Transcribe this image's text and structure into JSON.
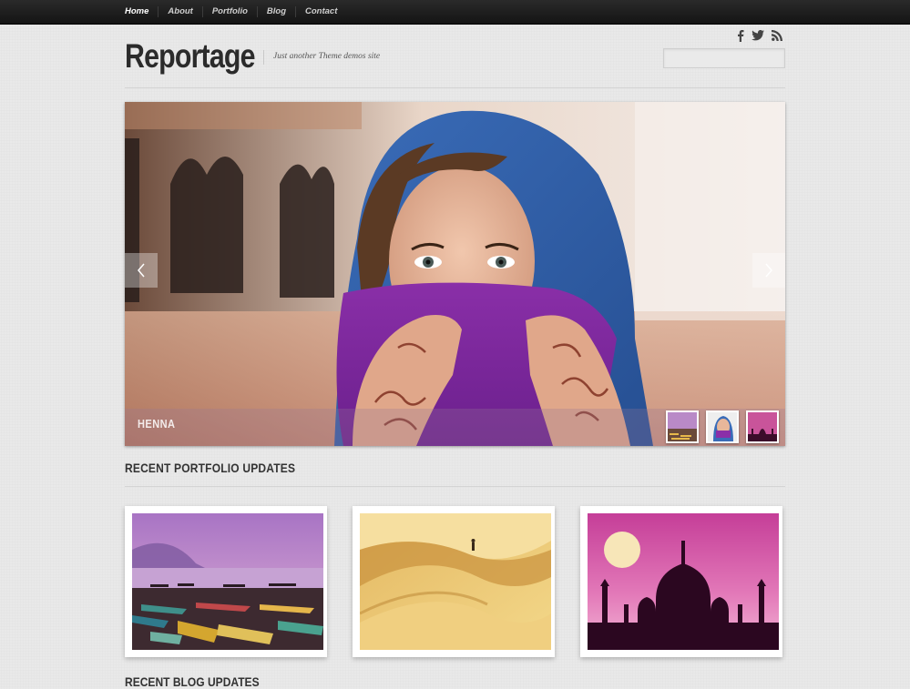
{
  "nav": {
    "items": [
      "Home",
      "About",
      "Portfolio",
      "Blog",
      "Contact"
    ]
  },
  "header": {
    "site_title": "Reportage",
    "tagline": "Just another Theme demos site",
    "social_icons": [
      "facebook-icon",
      "twitter-icon",
      "rss-icon"
    ],
    "search_placeholder": ""
  },
  "slider": {
    "caption_title": "HENNA",
    "prev_icon": "chevron-left-icon",
    "next_icon": "chevron-right-icon",
    "thumbnails": [
      "boats-thumbnail",
      "henna-thumbnail",
      "taj-mahal-thumbnail"
    ]
  },
  "portfolio": {
    "title": "RECENT PORTFOLIO UPDATES",
    "items": [
      "boats-on-lake",
      "desert-dunes",
      "taj-mahal-silhouette"
    ]
  },
  "blog": {
    "title": "RECENT BLOG UPDATES"
  },
  "colors": {
    "topbar": "#1b1b1b",
    "background": "#e9e9e9",
    "title": "#2b2b2b"
  }
}
